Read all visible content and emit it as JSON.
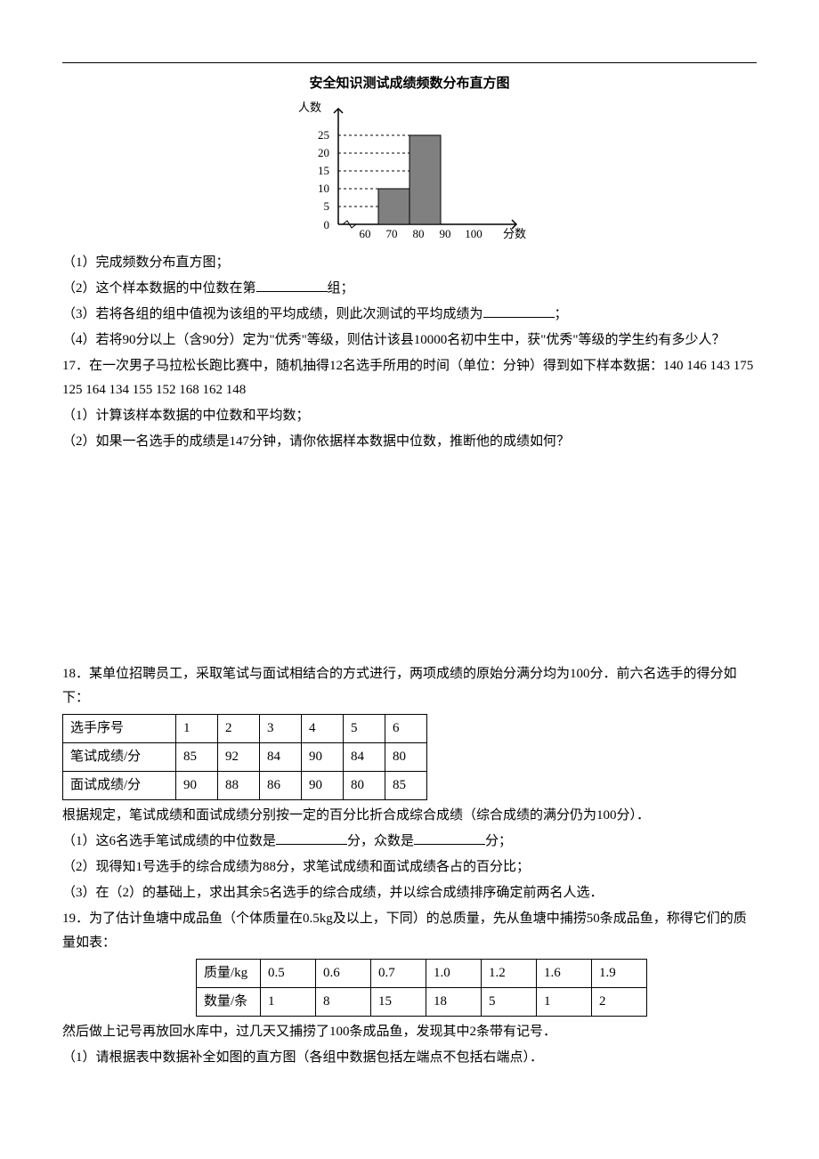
{
  "chart_data": {
    "type": "bar",
    "title": "安全知识测试成绩频数分布直方图",
    "xlabel": "分数",
    "ylabel": "人数",
    "categories": [
      "60",
      "70",
      "80",
      "90",
      "100"
    ],
    "x_ticks": [
      60,
      70,
      80,
      90,
      100
    ],
    "y_ticks": [
      0,
      5,
      10,
      15,
      20,
      25
    ],
    "values": [
      null,
      10,
      25,
      null
    ],
    "ylim": [
      0,
      25
    ]
  },
  "q16": {
    "sub1": "（1）完成频数分布直方图；",
    "sub2a": "（2）这个样本数据的中位数在第",
    "sub2b": "组；",
    "sub3a": "（3）若将各组的组中值视为该组的平均成绩，则此次测试的平均成绩为",
    "sub3b": "；",
    "sub4": "（4）若将90分以上（含90分）定为\"优秀\"等级，则估计该县10000名初中生中，获\"优秀\"等级的学生约有多少人？"
  },
  "q17": {
    "stem": "17．在一次男子马拉松长跑比赛中，随机抽得12名选手所用的时间（单位：分钟）得到如下样本数据：140  146  143  175  125  164  134  155  152  168  162  148",
    "sub1": "（1）计算该样本数据的中位数和平均数；",
    "sub2": "（2）如果一名选手的成绩是147分钟，请你依据样本数据中位数，推断他的成绩如何？"
  },
  "q18": {
    "stem": "18．某单位招聘员工，采取笔试与面试相结合的方式进行，两项成绩的原始分满分均为100分．前六名选手的得分如下：",
    "table": {
      "headers": [
        "选手序号",
        "1",
        "2",
        "3",
        "4",
        "5",
        "6"
      ],
      "row1": [
        "笔试成绩/分",
        "85",
        "92",
        "84",
        "90",
        "84",
        "80"
      ],
      "row2": [
        "面试成绩/分",
        "90",
        "88",
        "86",
        "90",
        "80",
        "85"
      ]
    },
    "after_table": "根据规定，笔试成绩和面试成绩分别按一定的百分比折合成综合成绩（综合成绩的满分仍为100分）．",
    "sub1a": "（1）这6名选手笔试成绩的中位数是",
    "sub1b": "分，众数是",
    "sub1c": "分；",
    "sub2": "（2）现得知1号选手的综合成绩为88分，求笔试成绩和面试成绩各占的百分比；",
    "sub3": "（3）在（2）的基础上，求出其余5名选手的综合成绩，并以综合成绩排序确定前两名人选．"
  },
  "q19": {
    "stem": "19．为了估计鱼塘中成品鱼（个体质量在0.5kg及以上，下同）的总质量，先从鱼塘中捕捞50条成品鱼，称得它们的质量如表：",
    "table": {
      "row1": [
        "质量/kg",
        "0.5",
        "0.6",
        "0.7",
        "1.0",
        "1.2",
        "1.6",
        "1.9"
      ],
      "row2": [
        "数量/条",
        "1",
        "8",
        "15",
        "18",
        "5",
        "1",
        "2"
      ]
    },
    "after_table": "然后做上记号再放回水库中，过几天又捕捞了100条成品鱼，发现其中2条带有记号．",
    "sub1": "（1）请根据表中数据补全如图的直方图（各组中数据包括左端点不包括右端点）．"
  }
}
